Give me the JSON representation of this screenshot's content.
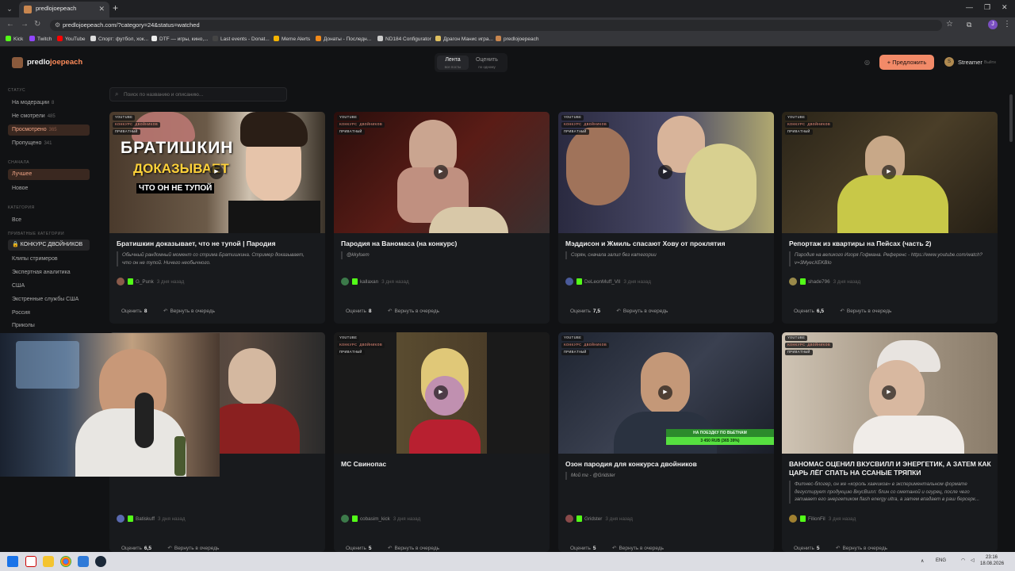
{
  "browser": {
    "tab_title": "predlojoepeach",
    "new_tab": "+",
    "url": "predlojoepeach.com/?category=24&status=watched",
    "bookmarks": [
      "Kick",
      "Twitch",
      "YouTube",
      "Спорт: футбол, хок...",
      "DTF — игры, кино,...",
      "Last events - Donat...",
      "Meme Alerts",
      "Донаты - Последн...",
      "ND184 Configurator",
      "Драгон Манис игра...",
      "predlojoepeach"
    ],
    "profile_initial": "J"
  },
  "header": {
    "logo_prefix": "predlo",
    "logo_suffix": "joepeach",
    "seg_feed": "Лента",
    "seg_feed_sub": "все посты",
    "seg_rate": "Оценить",
    "seg_rate_sub": "по одному",
    "suggest_button": "+ Предложить",
    "user_initial": "S",
    "user_name": "Streamer",
    "logout": "Выйти"
  },
  "sidebar": {
    "status_head": "СТАТУС",
    "status": [
      {
        "label": "На модерации",
        "count": "8"
      },
      {
        "label": "Не смотрели",
        "count": "485"
      },
      {
        "label": "Просмотрено",
        "count": "365"
      },
      {
        "label": "Пропущено",
        "count": "341"
      }
    ],
    "sort_head": "СНАЧАЛА",
    "sort": [
      "Лучшее",
      "Новое"
    ],
    "cat_head": "КАТЕГОРИЯ",
    "all": "Все",
    "private_head": "ПРИВАТНЫЕ КАТЕГОРИИ",
    "categories": [
      "🔒 КОНКУРС ДВОЙНИКОВ",
      "Клипы стримеров",
      "Экспертная аналитика",
      "США",
      "Экстренные службы США",
      "Россия",
      "Приколы"
    ]
  },
  "search": {
    "placeholder": "Поиск по названию и описанию..."
  },
  "tags": {
    "youtube": "YOUTUBE",
    "contest": "КОНКУРС ДВОЙНИКОВ",
    "private": "ПРИВАТНЫЙ"
  },
  "labels": {
    "rate": "Оценить",
    "requeue": "Вернуть в очередь",
    "ago": "3 дня назад"
  },
  "cards": [
    {
      "title": "Братишкин доказывает, что не тупой | Пародия",
      "desc": "Обычный рандомный момент со стрима Братишкина. Стример доказывает, что он не тупой. Ничего необычного.",
      "author": "G_Punk",
      "author_initial": "G",
      "score": "8",
      "thumb_title_1": "БРАТИШКИН",
      "thumb_title_2": "ДОКАЗЫВАЕТ",
      "thumb_title_3": "ЧТО ОН НЕ ТУПОЙ"
    },
    {
      "title": "Пародия на Ваномаса (на конкурс)",
      "desc": "@kkylsem",
      "author": "kallaxan",
      "author_initial": "K",
      "score": "8"
    },
    {
      "title": "Мэддисон и Жмиль спасают Хову от проклятия",
      "desc": "Сорян, сначала залил без категории",
      "author": "DeLeonMuff_VII",
      "author_initial": "D",
      "score": "7,5"
    },
    {
      "title": "Репортаж из квартиры на Пейсах (часть 2)",
      "desc": "Пародия на великого Игоря Гофмана. Референс - https://www.youtube.com/watch?v=3MyecXEKBIo",
      "author": "shade796",
      "author_initial": "S",
      "score": "6,5"
    },
    {
      "title": "",
      "desc": "",
      "author": "Batiskuff",
      "author_initial": "B",
      "score": "6,5"
    },
    {
      "title": "МС Свинопас",
      "desc": "",
      "author": "cobasim_kick",
      "author_initial": "C",
      "score": "5"
    },
    {
      "title": "Озон пародия для конкурса двойников",
      "desc": "Мой тг - @Gridster",
      "author": "Gridster",
      "author_initial": "G",
      "score": "5",
      "thumb_banner_1": "НА ПОЕЗДКУ ПО ВЬЕТНАМ",
      "thumb_banner_2": "3 450 RUB (365 39%)"
    },
    {
      "title": "ВАНОМАС ОЦЕНИЛ ВКУСВИЛЛ И ЭНЕРГЕТИК, А ЗАТЕМ КАК ЦАРЬ ЛЁГ СПАТЬ НА ССАНЫЕ ТРЯПКИ",
      "desc": "Фитнес-блогер, он же «король хавчиков» в экспериментальном формате дегустирует продукцию ВкусВилл: блин со сметаной и огурец, после чего запивает его энергетиком flash energy ultra, а затем впадает в раш берсерк...",
      "author": "FilionFil",
      "author_initial": "F",
      "score": "5"
    }
  ],
  "taskbar": {
    "lang": "ENG",
    "time": "23:16",
    "date": "18.08.2026"
  },
  "colors": {
    "accent": "#f28a68",
    "kick": "#53fc18",
    "bg": "#111214",
    "card": "#181a1d"
  }
}
